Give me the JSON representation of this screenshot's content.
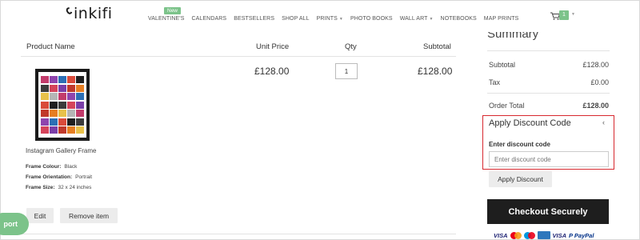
{
  "header": {
    "brand": "inkifi",
    "new_badge": "New",
    "nav": [
      {
        "label": "VALENTINE'S",
        "caret": false
      },
      {
        "label": "CALENDARS",
        "caret": false
      },
      {
        "label": "BESTSELLERS",
        "caret": false
      },
      {
        "label": "SHOP ALL",
        "caret": false
      },
      {
        "label": "PRINTS",
        "caret": true
      },
      {
        "label": "PHOTO BOOKS",
        "caret": false
      },
      {
        "label": "WALL ART",
        "caret": true
      },
      {
        "label": "NOTEBOOKS",
        "caret": false
      },
      {
        "label": "MAP PRINTS",
        "caret": false
      }
    ],
    "cart_count": "1",
    "cart_icon": "cart-icon"
  },
  "cart": {
    "columns": {
      "product": "Product Name",
      "unit_price": "Unit Price",
      "qty": "Qty",
      "subtotal": "Subtotal"
    },
    "item": {
      "name": "Instagram Gallery Frame",
      "unit_price": "£128.00",
      "qty": "1",
      "subtotal": "£128.00",
      "attributes": [
        {
          "label": "Frame Colour:",
          "value": "Black"
        },
        {
          "label": "Frame Orientation:",
          "value": "Portrait"
        },
        {
          "label": "Frame Size:",
          "value": "32 x 24 inches"
        }
      ],
      "edit_label": "Edit",
      "remove_label": "Remove item"
    },
    "support_label": "port"
  },
  "summary": {
    "title": "Summary",
    "subtotal_label": "Subtotal",
    "subtotal_value": "£128.00",
    "tax_label": "Tax",
    "tax_value": "£0.00",
    "total_label": "Order Total",
    "total_value": "£128.00",
    "discount": {
      "title": "Apply Discount Code",
      "field_label": "Enter discount code",
      "placeholder": "Enter discount code",
      "apply_label": "Apply Discount"
    },
    "checkout_label": "Checkout Securely",
    "payments": [
      "VISA",
      "mastercard",
      "maestro",
      "amex",
      "VISA",
      "P PayPal"
    ]
  },
  "colors": {
    "accent_green": "#7cc38a",
    "highlight_red": "#d7282f",
    "checkout_bg": "#1e1e1e",
    "visa_blue": "#1a1f71",
    "paypal_blue": "#003087"
  }
}
